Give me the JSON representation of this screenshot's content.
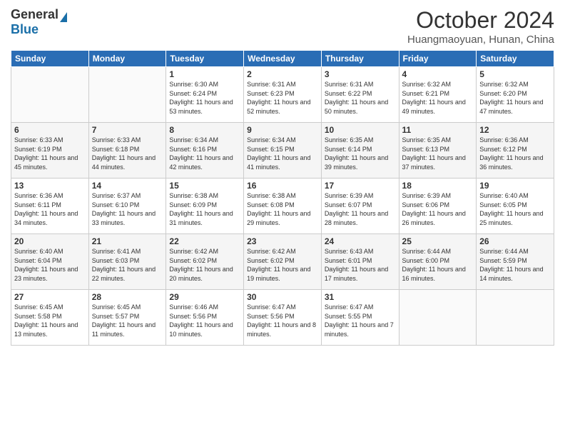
{
  "logo": {
    "general": "General",
    "blue": "Blue"
  },
  "header": {
    "month": "October 2024",
    "location": "Huangmaoyuan, Hunan, China"
  },
  "days_of_week": [
    "Sunday",
    "Monday",
    "Tuesday",
    "Wednesday",
    "Thursday",
    "Friday",
    "Saturday"
  ],
  "weeks": [
    [
      {
        "day": "",
        "info": ""
      },
      {
        "day": "",
        "info": ""
      },
      {
        "day": "1",
        "info": "Sunrise: 6:30 AM\nSunset: 6:24 PM\nDaylight: 11 hours and 53 minutes."
      },
      {
        "day": "2",
        "info": "Sunrise: 6:31 AM\nSunset: 6:23 PM\nDaylight: 11 hours and 52 minutes."
      },
      {
        "day": "3",
        "info": "Sunrise: 6:31 AM\nSunset: 6:22 PM\nDaylight: 11 hours and 50 minutes."
      },
      {
        "day": "4",
        "info": "Sunrise: 6:32 AM\nSunset: 6:21 PM\nDaylight: 11 hours and 49 minutes."
      },
      {
        "day": "5",
        "info": "Sunrise: 6:32 AM\nSunset: 6:20 PM\nDaylight: 11 hours and 47 minutes."
      }
    ],
    [
      {
        "day": "6",
        "info": "Sunrise: 6:33 AM\nSunset: 6:19 PM\nDaylight: 11 hours and 45 minutes."
      },
      {
        "day": "7",
        "info": "Sunrise: 6:33 AM\nSunset: 6:18 PM\nDaylight: 11 hours and 44 minutes."
      },
      {
        "day": "8",
        "info": "Sunrise: 6:34 AM\nSunset: 6:16 PM\nDaylight: 11 hours and 42 minutes."
      },
      {
        "day": "9",
        "info": "Sunrise: 6:34 AM\nSunset: 6:15 PM\nDaylight: 11 hours and 41 minutes."
      },
      {
        "day": "10",
        "info": "Sunrise: 6:35 AM\nSunset: 6:14 PM\nDaylight: 11 hours and 39 minutes."
      },
      {
        "day": "11",
        "info": "Sunrise: 6:35 AM\nSunset: 6:13 PM\nDaylight: 11 hours and 37 minutes."
      },
      {
        "day": "12",
        "info": "Sunrise: 6:36 AM\nSunset: 6:12 PM\nDaylight: 11 hours and 36 minutes."
      }
    ],
    [
      {
        "day": "13",
        "info": "Sunrise: 6:36 AM\nSunset: 6:11 PM\nDaylight: 11 hours and 34 minutes."
      },
      {
        "day": "14",
        "info": "Sunrise: 6:37 AM\nSunset: 6:10 PM\nDaylight: 11 hours and 33 minutes."
      },
      {
        "day": "15",
        "info": "Sunrise: 6:38 AM\nSunset: 6:09 PM\nDaylight: 11 hours and 31 minutes."
      },
      {
        "day": "16",
        "info": "Sunrise: 6:38 AM\nSunset: 6:08 PM\nDaylight: 11 hours and 29 minutes."
      },
      {
        "day": "17",
        "info": "Sunrise: 6:39 AM\nSunset: 6:07 PM\nDaylight: 11 hours and 28 minutes."
      },
      {
        "day": "18",
        "info": "Sunrise: 6:39 AM\nSunset: 6:06 PM\nDaylight: 11 hours and 26 minutes."
      },
      {
        "day": "19",
        "info": "Sunrise: 6:40 AM\nSunset: 6:05 PM\nDaylight: 11 hours and 25 minutes."
      }
    ],
    [
      {
        "day": "20",
        "info": "Sunrise: 6:40 AM\nSunset: 6:04 PM\nDaylight: 11 hours and 23 minutes."
      },
      {
        "day": "21",
        "info": "Sunrise: 6:41 AM\nSunset: 6:03 PM\nDaylight: 11 hours and 22 minutes."
      },
      {
        "day": "22",
        "info": "Sunrise: 6:42 AM\nSunset: 6:02 PM\nDaylight: 11 hours and 20 minutes."
      },
      {
        "day": "23",
        "info": "Sunrise: 6:42 AM\nSunset: 6:02 PM\nDaylight: 11 hours and 19 minutes."
      },
      {
        "day": "24",
        "info": "Sunrise: 6:43 AM\nSunset: 6:01 PM\nDaylight: 11 hours and 17 minutes."
      },
      {
        "day": "25",
        "info": "Sunrise: 6:44 AM\nSunset: 6:00 PM\nDaylight: 11 hours and 16 minutes."
      },
      {
        "day": "26",
        "info": "Sunrise: 6:44 AM\nSunset: 5:59 PM\nDaylight: 11 hours and 14 minutes."
      }
    ],
    [
      {
        "day": "27",
        "info": "Sunrise: 6:45 AM\nSunset: 5:58 PM\nDaylight: 11 hours and 13 minutes."
      },
      {
        "day": "28",
        "info": "Sunrise: 6:45 AM\nSunset: 5:57 PM\nDaylight: 11 hours and 11 minutes."
      },
      {
        "day": "29",
        "info": "Sunrise: 6:46 AM\nSunset: 5:56 PM\nDaylight: 11 hours and 10 minutes."
      },
      {
        "day": "30",
        "info": "Sunrise: 6:47 AM\nSunset: 5:56 PM\nDaylight: 11 hours and 8 minutes."
      },
      {
        "day": "31",
        "info": "Sunrise: 6:47 AM\nSunset: 5:55 PM\nDaylight: 11 hours and 7 minutes."
      },
      {
        "day": "",
        "info": ""
      },
      {
        "day": "",
        "info": ""
      }
    ]
  ]
}
